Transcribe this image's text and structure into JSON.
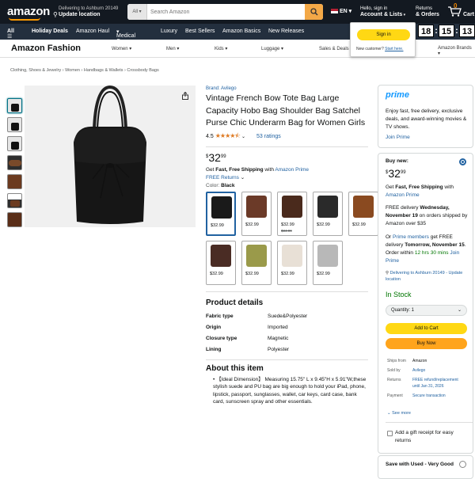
{
  "header": {
    "logo": "amazon",
    "deliver_line1": "Delivering to Ashburn 20149",
    "deliver_line2": "Update location",
    "search_category": "All",
    "search_placeholder": "Search Amazon",
    "language": "EN",
    "account_line1": "Hello, sign in",
    "account_line2": "Account & Lists",
    "orders_line1": "Returns",
    "orders_line2": "& Orders",
    "cart_count": "0",
    "cart_label": "Cart"
  },
  "nav": {
    "all": "All",
    "items": [
      "Holiday Deals",
      "Amazon Haul",
      "Medical Care",
      "Luxury",
      "Best Sellers",
      "Amazon Basics",
      "New Releases"
    ]
  },
  "signin_flyout": {
    "button": "Sign in",
    "new_customer": "New customer?",
    "start_here": "Start here."
  },
  "timer": {
    "h": "18",
    "m": "15",
    "s": "13"
  },
  "fashion": {
    "title": "Amazon Fashion",
    "items": [
      "Women",
      "Men",
      "Kids",
      "Luggage",
      "Sales & Deals",
      "Amazon Brands"
    ]
  },
  "breadcrumb": [
    "Clothing, Shoes & Jewelry",
    "Women",
    "Handbags & Wallets",
    "Crossbody Bags"
  ],
  "product": {
    "brand": "Brand: Avilego",
    "title": "Vintage French Bow Tote Bag Large Capacity Hobo Bag Shoulder Bag Satchel Purse Chic Underarm Bag for Women Girls",
    "rating": "4.5",
    "ratings_count": "53 ratings",
    "price_symbol": "$",
    "price_whole": "32",
    "price_fraction": "99",
    "ship_prefix": "Get ",
    "ship_bold": "Fast, Free Shipping",
    "ship_with": " with ",
    "ship_prime": "Amazon Prime",
    "free_returns": "FREE Returns",
    "color_label": "Color: ",
    "color_value": "Black",
    "swatches": [
      {
        "price": "$32.99",
        "old": "",
        "color": "#1a1a1a"
      },
      {
        "price": "$32.99",
        "old": "",
        "color": "#6b3a28"
      },
      {
        "price": "$32.99",
        "old": "$34.99",
        "color": "#4a2a1c"
      },
      {
        "price": "$32.99",
        "old": "",
        "color": "#2a2a2a"
      },
      {
        "price": "$32.99",
        "old": "",
        "color": "#8a4a20"
      },
      {
        "price": "$32.99",
        "old": "",
        "color": "#4a2c24"
      },
      {
        "price": "$32.99",
        "old": "",
        "color": "#9a9a4a"
      },
      {
        "price": "$32.99",
        "old": "",
        "color": "#e8e0d6"
      },
      {
        "price": "$32.99",
        "old": "",
        "color": "#b8b8b8"
      }
    ],
    "details_title": "Product details",
    "details": [
      {
        "k": "Fabric type",
        "v": "Suede&Polyester"
      },
      {
        "k": "Origin",
        "v": "Imported"
      },
      {
        "k": "Closure type",
        "v": "Magnetic"
      },
      {
        "k": "Lining",
        "v": "Polyester"
      }
    ],
    "about_title": "About this item",
    "about_text": "【Ideal Dimension】 Measuring 15.75\" L x 9.45\"H x 5.91\"W,these stylish suede and PU bag are big enough to hold your iPad, phone, lipstick, passport, sunglasses, wallet, car keys, card case, bank card, sunscreen spray and other essentials."
  },
  "prime_box": {
    "logo": "prime",
    "text": "Enjoy fast, free delivery, exclusive deals, and award-winning movies & TV shows.",
    "link": "Join Prime"
  },
  "buy_box": {
    "label": "Buy new:",
    "price_whole": "32",
    "price_fraction": "99",
    "ship_prefix": "Get ",
    "ship_bold": "Fast, Free Shipping",
    "ship_with": " with ",
    "ship_prime": "Amazon Prime",
    "free_delivery": "FREE delivery ",
    "free_delivery_date": "Wednesday, November 19",
    "free_delivery_tail": " on orders shipped by Amazon over $35",
    "or": "Or ",
    "prime_members": "Prime members",
    "fastest": " get FREE delivery ",
    "fastest_date": "Tomorrow, November 15",
    "order_within": ". Order within ",
    "countdown": "12 hrs 30 mins",
    "join_prime": "Join Prime",
    "deliver_to": "Delivering to Ashburn 20149 - Update location",
    "stock": "In Stock",
    "quantity": "Quantity: 1",
    "add_to_cart": "Add to Cart",
    "buy_now": "Buy Now",
    "info": [
      {
        "k": "Ships from",
        "v": "Amazon"
      },
      {
        "k": "Sold by",
        "v": "Avilego"
      },
      {
        "k": "Returns",
        "v": "FREE refund/replacement until Jan 31, 2026"
      },
      {
        "k": "Payment",
        "v": "Secure transaction"
      }
    ],
    "see_more": "See more",
    "gift": "Add a gift receipt for easy returns"
  },
  "used_box": {
    "label": "Save with Used - Very Good"
  },
  "colors": {
    "header_bg": "#131921",
    "nav_bg": "#232f3e",
    "accent": "#ff9900",
    "link": "#2162a1",
    "add_to_cart": "#ffd814",
    "buy_now": "#ffa41c",
    "in_stock": "#007600"
  }
}
